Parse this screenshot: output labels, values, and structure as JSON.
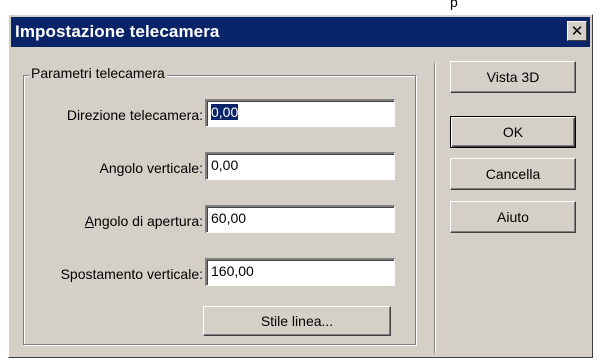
{
  "window": {
    "title": "Impostazione telecamera",
    "close_glyph": "✕"
  },
  "group": {
    "legend": "Parametri telecamera"
  },
  "fields": {
    "direzione": {
      "label": "Direzione telecamera:",
      "value": "0,00"
    },
    "angolo_verticale": {
      "label": "Angolo verticale:",
      "value": "0,00"
    },
    "angolo_apertura": {
      "label_prefix": "A",
      "label_rest": "ngolo di apertura:",
      "value": "60,00"
    },
    "spostamento": {
      "label": "Spostamento verticale:",
      "value": "160,00"
    }
  },
  "buttons": {
    "stile_linea": "Stile linea...",
    "vista_3d": "Vista 3D",
    "ok": "OK",
    "cancella": "Cancella",
    "aiuto": "Aiuto"
  },
  "background_fragment": "p"
}
